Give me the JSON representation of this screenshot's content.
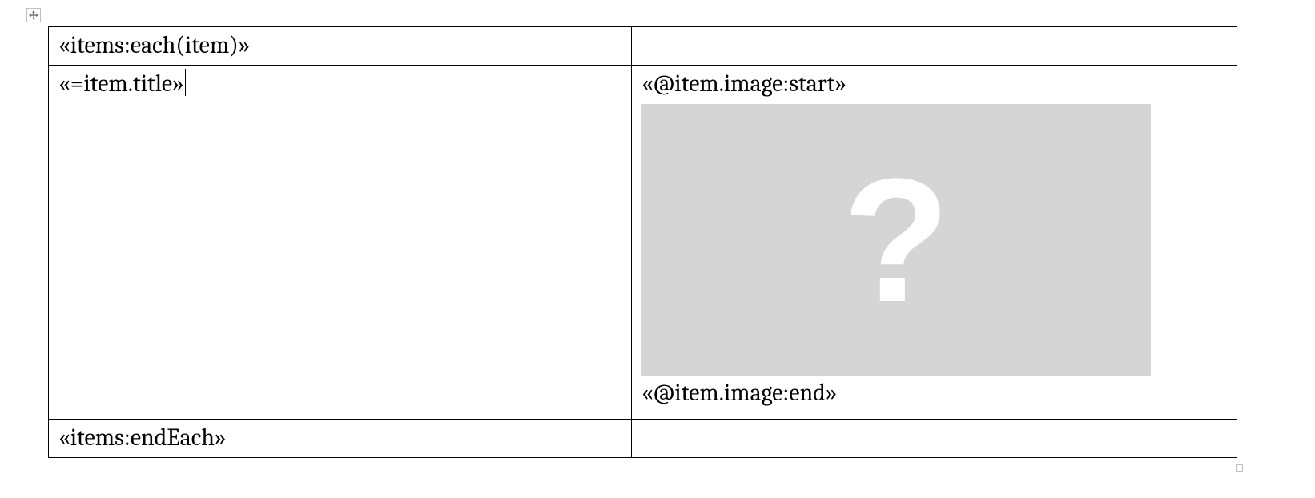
{
  "table": {
    "rows": [
      {
        "left": "«items:each(item)»",
        "right": ""
      },
      {
        "left": "«=item.title»",
        "right_start": "«@item.image:start»",
        "right_end": "«@item.image:end»",
        "placeholder_glyph": "?"
      },
      {
        "left": "«items:endEach»",
        "right": ""
      }
    ]
  },
  "handles": {
    "move_icon": "move-4-way",
    "resize_icon": "resize-corner"
  }
}
